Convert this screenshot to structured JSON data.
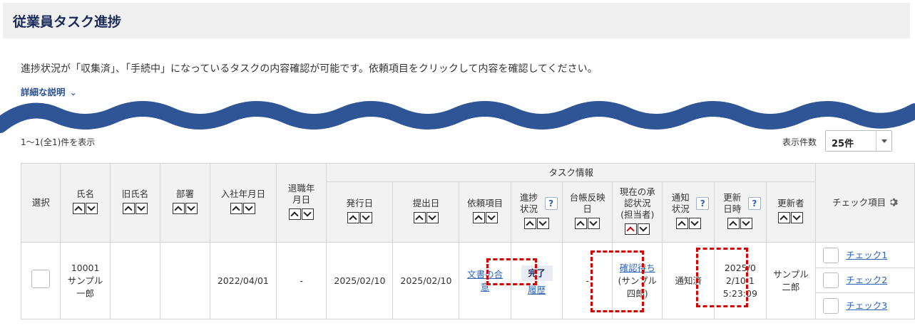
{
  "page": {
    "title": "従業員タスク進捗",
    "description": "進捗状況が「収集済」、「手続中」になっているタスクの内容確認が可能です。依頼項目をクリックして内容を確認してください。",
    "detail_link": "詳細な説明"
  },
  "list": {
    "count_text": "1〜1(全1)件を表示",
    "per_page_label": "表示件数",
    "per_page_value": "25件"
  },
  "table": {
    "group_header": "タスク情報",
    "headers": {
      "select": "選択",
      "name": "氏名",
      "old_name": "旧氏名",
      "dept": "部署",
      "join_date": "入社年月日",
      "leave_date": "退職年月日",
      "issue_date": "発行日",
      "submit_date": "提出日",
      "request_item": "依頼項目",
      "progress": "進捗状況",
      "ledger": "台帳反映日",
      "approval": "現在の承認状況 (担当者)",
      "notice": "通知状況",
      "updated_at": "更新日時",
      "updater": "更新者",
      "check_items": "チェック項目"
    },
    "row": {
      "id": "10001",
      "name": "サンプル一郎",
      "old_name": "",
      "dept": "",
      "join_date": "2022/04/01",
      "leave_date": "-",
      "issue_date": "2025/02/10",
      "submit_date": "2025/02/10",
      "request_item": "文書の合意",
      "progress_badge": "完了",
      "progress_history": "履歴",
      "ledger": "-",
      "approval_status": "確認待ち",
      "approval_person": "(サンプル　四郎)",
      "notice": "通知済",
      "updated_at": "2025/02/10 15:23:09",
      "updater": "サンプル二郎",
      "checks": [
        "チェック1",
        "チェック2",
        "チェック3"
      ]
    }
  },
  "colors": {
    "accent": "#1a2a5c",
    "link": "#2a63b5",
    "highlight": "#d40000",
    "wave": "#2f5597"
  }
}
